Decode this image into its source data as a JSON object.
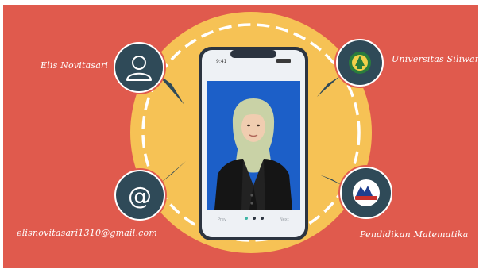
{
  "slide": {
    "colors": {
      "background": "#e05a4d",
      "circle": "#f6c255",
      "badge": "#2f4a58",
      "screen": "#1c5fc8",
      "phone": "#2c3440"
    }
  },
  "profile": {
    "name": "Elis Novitasari",
    "email": "elisnovitasari1310@gmail.com",
    "university": "Universitas Siliwangi",
    "department": "Pendidikan Matematika"
  },
  "icons": {
    "name": "user-icon",
    "email": "at-sign-icon",
    "university": "university-logo-icon",
    "department": "department-logo-icon"
  }
}
